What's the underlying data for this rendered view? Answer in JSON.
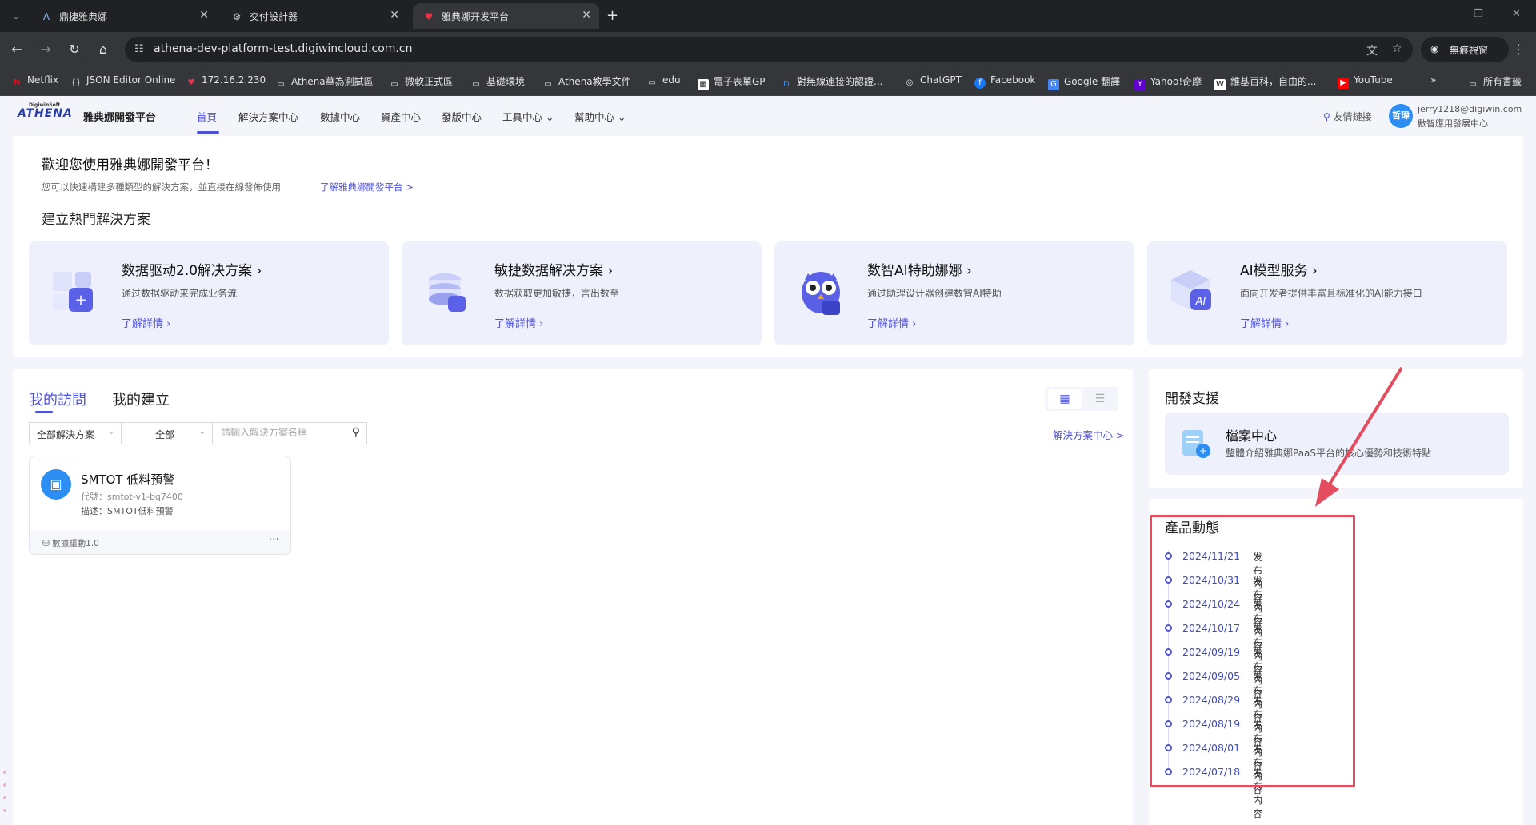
{
  "browser": {
    "tabs": [
      {
        "title": "鼎捷雅典娜",
        "icon": "athena-icon"
      },
      {
        "title": "交付設計器",
        "icon": "designer-icon"
      },
      {
        "title": "雅典娜开发平台",
        "icon": "platform-icon"
      }
    ],
    "url": "athena-dev-platform-test.digiwincloud.com.cn",
    "incognito_label": "無痕視窗",
    "bookmarks": [
      "Netflix",
      "JSON Editor Online",
      "172.16.2.230",
      "Athena華為測試區",
      "微軟正式區",
      "基礎環境",
      "Athena教學文件",
      "edu",
      "電子表單GP",
      "對無線連接的認證...",
      "ChatGPT",
      "Facebook",
      "Google 翻譯",
      "Yahoo!奇摩",
      "維基百科，自由的...",
      "YouTube"
    ],
    "all_bookmarks": "所有書籤"
  },
  "app": {
    "logo_small": "DigiwinSoft",
    "logo": "ATHENA",
    "platform_name": "雅典娜開發平台",
    "menu": [
      "首頁",
      "解決方案中心",
      "數據中心",
      "資產中心",
      "發版中心",
      "工具中心 ⌄",
      "幫助中心 ⌄"
    ],
    "friend_link": "友情鏈接",
    "avatar_text": "哲瑋",
    "user_email": "jerry1218@digiwin.com",
    "user_org": "數智應用發展中心"
  },
  "welcome": {
    "title": "歡迎您使用雅典娜開發平台！",
    "subtitle": "您可以快速構建多種類型的解決方案，並直接在線發佈使用",
    "link": "了解雅典娜開發平台 >",
    "hot_title": "建立熱門解決方案",
    "cards": [
      {
        "title": "数据驱动2.0解决方案 ›",
        "desc": "通过数据驱动来完成业务流",
        "more": "了解詳情 ›"
      },
      {
        "title": "敏捷数据解决方案 ›",
        "desc": "数据获取更加敏捷，言出数至",
        "more": "了解詳情 ›"
      },
      {
        "title": "数智AI特助娜娜 ›",
        "desc": "通过助理设计器创建数智AI特助",
        "more": "了解詳情 ›"
      },
      {
        "title": "AI模型服务 ›",
        "desc": "面向开发者提供丰富且标准化的AI能力接口",
        "more": "了解詳情 ›"
      }
    ]
  },
  "visits": {
    "tabs": [
      "我的訪問",
      "我的建立"
    ],
    "filter_type": "全部解決方案",
    "filter_all": "全部",
    "search_placeholder": "請輸入解決方案名稱",
    "solution_center_link": "解決方案中心 >",
    "solution": {
      "name": "SMTOT 低料預警",
      "code": "代號：smtot-v1-bq7400",
      "desc": "描述：SMTOT低料預警",
      "tag": "數據驅動1.0",
      "more": "···"
    }
  },
  "support": {
    "title": "開發支援",
    "doc_title": "檔案中心",
    "doc_desc": "整體介紹雅典娜PaaS平台的核心優勢和技術特點"
  },
  "news": {
    "title": "產品動態",
    "items": [
      {
        "date": "2024/11/21",
        "label": "发布内容"
      },
      {
        "date": "2024/10/31",
        "label": "发布内容"
      },
      {
        "date": "2024/10/24",
        "label": "发布内容"
      },
      {
        "date": "2024/10/17",
        "label": "发布内容"
      },
      {
        "date": "2024/09/19",
        "label": "发布内容"
      },
      {
        "date": "2024/09/05",
        "label": "发布内容"
      },
      {
        "date": "2024/08/29",
        "label": "发布内容"
      },
      {
        "date": "2024/08/19",
        "label": "发布内容"
      },
      {
        "date": "2024/08/01",
        "label": "发布内容"
      },
      {
        "date": "2024/07/18",
        "label": "发布内容"
      }
    ]
  },
  "colors": {
    "accent": "#4e52d6",
    "annotation": "#e34d5f"
  }
}
